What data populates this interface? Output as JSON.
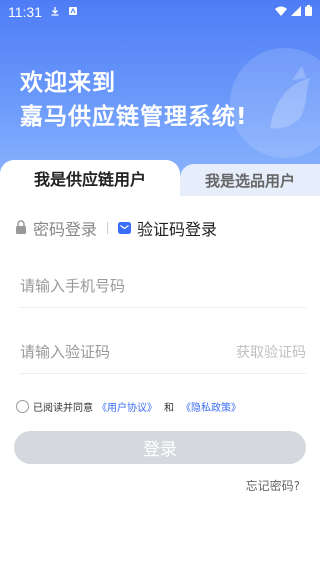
{
  "status_bar": {
    "time": "11:31",
    "left_icons": [
      "download-icon",
      "sim-notification-icon"
    ],
    "right_icons": [
      "wifi-icon",
      "signal-icon",
      "battery-icon"
    ]
  },
  "hero": {
    "line1": "欢迎来到",
    "line2": "嘉马供应链管理系统!"
  },
  "tabs": {
    "supplier": "我是供应链用户",
    "selector": "我是选品用户"
  },
  "login_modes": {
    "password": "密码登录",
    "sms": "验证码登录"
  },
  "form": {
    "phone_placeholder": "请输入手机号码",
    "code_placeholder": "请输入验证码",
    "get_code": "获取验证码"
  },
  "agreement": {
    "prefix": "已阅读并同意",
    "user_agreement": "《用户协议》",
    "and": "和",
    "privacy": "《隐私政策》"
  },
  "login_button": "登录",
  "forgot_password": "忘记密码?",
  "colors": {
    "brand_blue": "#4e7cf6",
    "link": "#3b6ef5",
    "disabled_button": "#d5d8dd"
  }
}
